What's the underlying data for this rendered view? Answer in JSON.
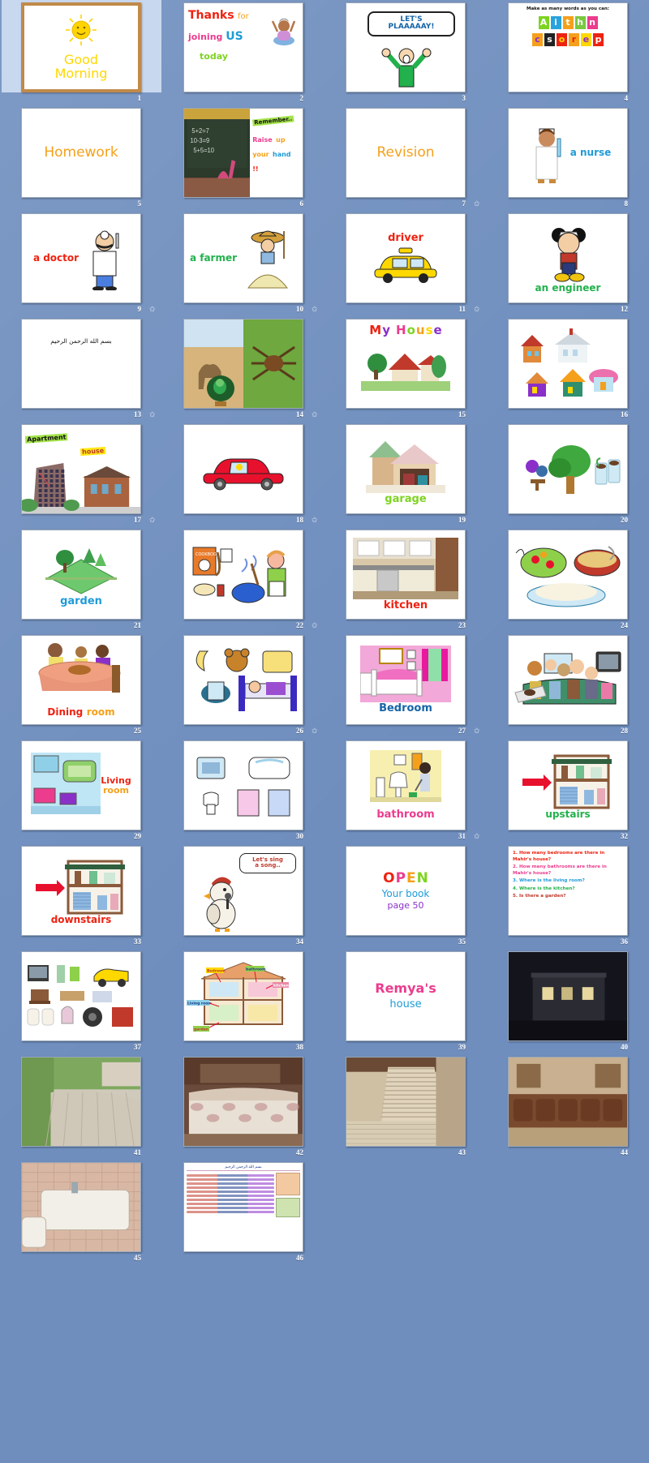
{
  "app": {
    "view": "slide-sorter",
    "background_color": "#6f8ebe",
    "total_slides": 46,
    "columns": 4
  },
  "slides": [
    {
      "n": 1,
      "selected": true,
      "animated": false,
      "kind": "good-morning",
      "texts": [
        "Good",
        "Morning"
      ],
      "colors": [
        "#ffd800",
        "#ffd800"
      ]
    },
    {
      "n": 2,
      "selected": false,
      "animated": false,
      "kind": "thanks",
      "texts": [
        "Thanks",
        "for",
        "joining",
        "US",
        "today"
      ],
      "colors": [
        "#ee2211",
        "#f5a01b",
        "#ec3c8e",
        "#1f9bd8",
        "#7ed321"
      ]
    },
    {
      "n": 3,
      "selected": false,
      "animated": false,
      "kind": "lets-play",
      "texts": [
        "LET'S",
        "PLAAAAAY!"
      ],
      "colors": [
        "#1565a8",
        "#1565a8"
      ]
    },
    {
      "n": 4,
      "selected": false,
      "animated": false,
      "kind": "word-tiles",
      "texts": [
        "Make as many words as you can:"
      ],
      "tiles_row1": [
        "A",
        "i",
        "t",
        "h",
        "n"
      ],
      "tiles_row2": [
        "c",
        "s",
        "o",
        "r",
        "e",
        "p"
      ]
    },
    {
      "n": 5,
      "selected": false,
      "animated": false,
      "kind": "title-only",
      "texts": [
        "Homework"
      ],
      "colors": [
        "#f5a01b"
      ]
    },
    {
      "n": 6,
      "selected": false,
      "animated": false,
      "kind": "remember",
      "texts": [
        "Remember..",
        "Raise",
        "up",
        "your",
        "hand",
        "!!"
      ],
      "colors": [
        "#222222",
        "#ec3c8e",
        "#f5a01b",
        "#f5a01b",
        "#1f9bd8",
        "#ee2211"
      ]
    },
    {
      "n": 7,
      "selected": false,
      "animated": false,
      "kind": "title-only",
      "texts": [
        "Revision"
      ],
      "colors": [
        "#f5a01b"
      ]
    },
    {
      "n": 8,
      "selected": false,
      "animated": true,
      "kind": "job",
      "texts": [
        "a nurse"
      ],
      "colors": [
        "#1f9bd8"
      ]
    },
    {
      "n": 9,
      "selected": false,
      "animated": true,
      "kind": "job",
      "texts": [
        "a doctor"
      ],
      "colors": [
        "#ee2211"
      ]
    },
    {
      "n": 10,
      "selected": false,
      "animated": true,
      "kind": "job",
      "texts": [
        "a farmer"
      ],
      "colors": [
        "#22b14c"
      ]
    },
    {
      "n": 11,
      "selected": false,
      "animated": true,
      "kind": "job",
      "texts": [
        "driver"
      ],
      "colors": [
        "#ee2211"
      ]
    },
    {
      "n": 12,
      "selected": false,
      "animated": true,
      "kind": "job",
      "texts": [
        "an engineer"
      ],
      "colors": [
        "#22b14c"
      ]
    },
    {
      "n": 13,
      "selected": false,
      "animated": false,
      "kind": "arabic",
      "texts": [
        "بسم الله الرحمن الرحيم"
      ]
    },
    {
      "n": 14,
      "selected": false,
      "animated": true,
      "kind": "photo-animals",
      "texts": []
    },
    {
      "n": 15,
      "selected": false,
      "animated": true,
      "kind": "my-house",
      "texts": [
        "My",
        "House"
      ]
    },
    {
      "n": 16,
      "selected": false,
      "animated": false,
      "kind": "houses-grid",
      "texts": []
    },
    {
      "n": 17,
      "selected": false,
      "animated": false,
      "kind": "apartment-house",
      "texts": [
        "Apartment",
        "house"
      ]
    },
    {
      "n": 18,
      "selected": false,
      "animated": true,
      "kind": "red-car",
      "texts": []
    },
    {
      "n": 19,
      "selected": false,
      "animated": true,
      "kind": "room",
      "texts": [
        "garage"
      ],
      "colors": [
        "#7ed321"
      ]
    },
    {
      "n": 20,
      "selected": false,
      "animated": false,
      "kind": "tree-plants",
      "texts": []
    },
    {
      "n": 21,
      "selected": false,
      "animated": true,
      "kind": "room",
      "texts": [
        "garden"
      ],
      "colors": [
        "#1f9bd8"
      ]
    },
    {
      "n": 22,
      "selected": false,
      "animated": false,
      "kind": "kitchen-clipart",
      "texts": []
    },
    {
      "n": 23,
      "selected": false,
      "animated": true,
      "kind": "room",
      "texts": [
        "kitchen"
      ],
      "colors": [
        "#ee2211"
      ]
    },
    {
      "n": 24,
      "selected": false,
      "animated": false,
      "kind": "food",
      "texts": []
    },
    {
      "n": 25,
      "selected": false,
      "animated": false,
      "kind": "room2",
      "texts": [
        "Dining",
        "room"
      ],
      "colors": [
        "#ee2211",
        "#f5a01b"
      ]
    },
    {
      "n": 26,
      "selected": false,
      "animated": false,
      "kind": "bed-clipart",
      "texts": []
    },
    {
      "n": 27,
      "selected": false,
      "animated": true,
      "kind": "room",
      "texts": [
        "Bedroom"
      ],
      "colors": [
        "#1565a8"
      ]
    },
    {
      "n": 28,
      "selected": false,
      "animated": true,
      "kind": "family-sofa",
      "texts": []
    },
    {
      "n": 29,
      "selected": false,
      "animated": false,
      "kind": "room2",
      "texts": [
        "Living",
        "room"
      ],
      "colors": [
        "#ee2211",
        "#f5a01b"
      ]
    },
    {
      "n": 30,
      "selected": false,
      "animated": false,
      "kind": "bathroom-clipart",
      "texts": []
    },
    {
      "n": 31,
      "selected": false,
      "animated": false,
      "kind": "room",
      "texts": [
        "bathroom"
      ],
      "colors": [
        "#ec3c8e"
      ]
    },
    {
      "n": 32,
      "selected": false,
      "animated": true,
      "kind": "stairs-word",
      "texts": [
        "upstairs"
      ],
      "colors": [
        "#22b14c"
      ]
    },
    {
      "n": 33,
      "selected": false,
      "animated": false,
      "kind": "stairs-word",
      "texts": [
        "downstairs"
      ],
      "colors": [
        "#ee2211"
      ]
    },
    {
      "n": 34,
      "selected": false,
      "animated": false,
      "kind": "sing-song",
      "texts": [
        "Let's sing",
        "a song.."
      ]
    },
    {
      "n": 35,
      "selected": false,
      "animated": false,
      "kind": "open-book",
      "texts": [
        "OPEN",
        "Your book",
        "page 50"
      ]
    },
    {
      "n": 36,
      "selected": false,
      "animated": false,
      "kind": "questions",
      "questions": [
        "1. How many bedrooms are there in Mahir's house?",
        "2. How many bathrooms are there in Mahir's house?",
        "3. Where is the living room?",
        "4. Where is the kitchen?",
        "5. Is there a garden?"
      ]
    },
    {
      "n": 37,
      "selected": false,
      "animated": false,
      "kind": "objects-grid",
      "texts": []
    },
    {
      "n": 38,
      "selected": false,
      "animated": false,
      "kind": "labelled-house",
      "texts": [
        "Bedroom",
        "bathroom",
        "kitchen",
        "Living room",
        "garden"
      ]
    },
    {
      "n": 39,
      "selected": false,
      "animated": false,
      "kind": "remyas-house",
      "texts": [
        "Remya's",
        "house"
      ]
    },
    {
      "n": 40,
      "selected": false,
      "animated": false,
      "kind": "photo-night",
      "texts": []
    },
    {
      "n": 41,
      "selected": false,
      "animated": false,
      "kind": "photo-garden",
      "texts": []
    },
    {
      "n": 42,
      "selected": false,
      "animated": false,
      "kind": "photo-bedroom",
      "texts": []
    },
    {
      "n": 43,
      "selected": false,
      "animated": false,
      "kind": "photo-stairs",
      "texts": []
    },
    {
      "n": 44,
      "selected": false,
      "animated": false,
      "kind": "photo-majlis",
      "texts": []
    },
    {
      "n": 45,
      "selected": false,
      "animated": false,
      "kind": "photo-bathroom",
      "texts": []
    },
    {
      "n": 46,
      "selected": false,
      "animated": false,
      "kind": "arabic-doc",
      "texts": [
        "بسم الله الرحمن الرحيم"
      ]
    }
  ],
  "labels": {
    "animation_star": "✩",
    "sun_face": "☺"
  }
}
